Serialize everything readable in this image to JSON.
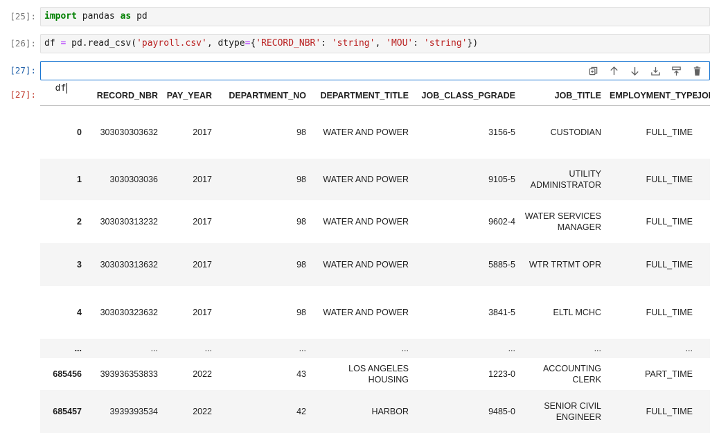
{
  "cells": [
    {
      "prompt": "[25]:",
      "code_tokens": [
        {
          "t": "import",
          "c": "kw"
        },
        {
          "t": " pandas "
        },
        {
          "t": "as",
          "c": "kw"
        },
        {
          "t": " pd"
        }
      ]
    },
    {
      "prompt": "[26]:",
      "code_tokens": [
        {
          "t": "df "
        },
        {
          "t": "=",
          "c": "op"
        },
        {
          "t": " pd.read_csv("
        },
        {
          "t": "'payroll.csv'",
          "c": "str"
        },
        {
          "t": ", dtype"
        },
        {
          "t": "=",
          "c": "op"
        },
        {
          "t": "{"
        },
        {
          "t": "'RECORD_NBR'",
          "c": "str"
        },
        {
          "t": ": "
        },
        {
          "t": "'string'",
          "c": "str"
        },
        {
          "t": ", "
        },
        {
          "t": "'MOU'",
          "c": "str"
        },
        {
          "t": ": "
        },
        {
          "t": "'string'",
          "c": "str"
        },
        {
          "t": "})"
        }
      ]
    },
    {
      "prompt": "[27]:",
      "code": "df"
    }
  ],
  "output_prompt": "[27]:",
  "toolbar_icons": [
    "duplicate-icon",
    "move-up-icon",
    "move-down-icon",
    "insert-below-icon",
    "insert-above-icon",
    "delete-icon"
  ],
  "table": {
    "columns": [
      "",
      "RECORD_NBR",
      "PAY_YEAR",
      "DEPARTMENT_NO",
      "DEPARTMENT_TITLE",
      "JOB_CLASS_PGRADE",
      "JOB_TITLE",
      "EMPLOYMENT_TYPE",
      "JOB"
    ],
    "rows": [
      {
        "index": "0",
        "cells": [
          "303030303632",
          "2017",
          "98",
          "WATER AND POWER",
          "3156-5",
          "CUSTODIAN",
          "FULL_TIME",
          ""
        ]
      },
      {
        "index": "1",
        "cells": [
          "3030303036",
          "2017",
          "98",
          "WATER AND POWER",
          "9105-5",
          "UTILITY ADMINISTRATOR",
          "FULL_TIME",
          ""
        ]
      },
      {
        "index": "2",
        "cells": [
          "303030313232",
          "2017",
          "98",
          "WATER AND POWER",
          "9602-4",
          "WATER SERVICES MANAGER",
          "FULL_TIME",
          ""
        ]
      },
      {
        "index": "3",
        "cells": [
          "303030313632",
          "2017",
          "98",
          "WATER AND POWER",
          "5885-5",
          "WTR TRTMT OPR",
          "FULL_TIME",
          ""
        ]
      },
      {
        "index": "4",
        "cells": [
          "303030323632",
          "2017",
          "98",
          "WATER AND POWER",
          "3841-5",
          "ELTL MCHC",
          "FULL_TIME",
          ""
        ]
      },
      {
        "index": "...",
        "cells": [
          "...",
          "...",
          "...",
          "...",
          "...",
          "...",
          "...",
          ""
        ]
      },
      {
        "index": "685456",
        "cells": [
          "393936353833",
          "2022",
          "43",
          "LOS ANGELES HOUSING",
          "1223-0",
          "ACCOUNTING CLERK",
          "PART_TIME",
          ""
        ]
      },
      {
        "index": "685457",
        "cells": [
          "3939393534",
          "2022",
          "42",
          "HARBOR",
          "9485-0",
          "SENIOR CIVIL ENGINEER",
          "FULL_TIME",
          ""
        ]
      }
    ]
  }
}
